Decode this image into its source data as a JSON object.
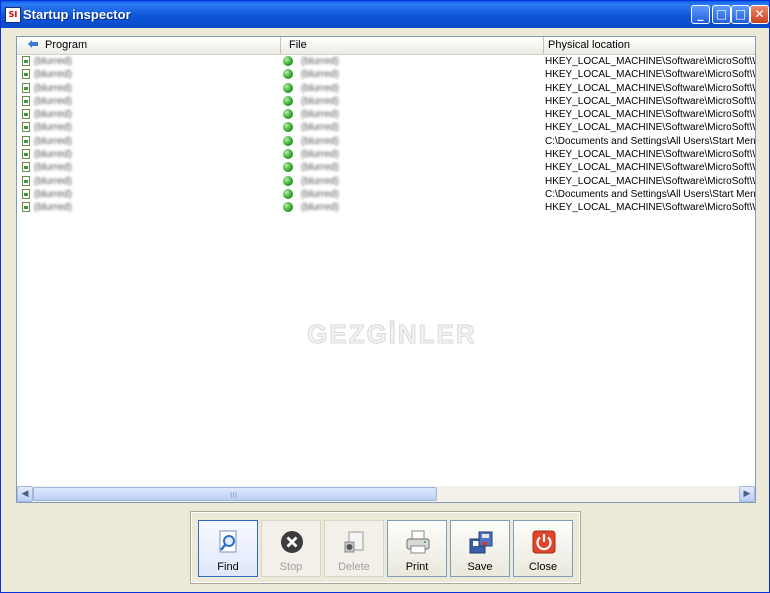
{
  "window": {
    "title": "Startup inspector",
    "app_icon_text": "SI",
    "controls": [
      "_",
      "□",
      "□",
      "✕"
    ]
  },
  "columns": [
    "Program",
    "File",
    "Physical location"
  ],
  "rows": [
    {
      "program": "(blurred)",
      "file": "(blurred)",
      "location": "HKEY_LOCAL_MACHINE\\Software\\MicroSoft\\Window"
    },
    {
      "program": "(blurred)",
      "file": "(blurred)",
      "location": "HKEY_LOCAL_MACHINE\\Software\\MicroSoft\\Window"
    },
    {
      "program": "(blurred)",
      "file": "(blurred)",
      "location": "HKEY_LOCAL_MACHINE\\Software\\MicroSoft\\Window"
    },
    {
      "program": "(blurred)",
      "file": "(blurred)",
      "location": "HKEY_LOCAL_MACHINE\\Software\\MicroSoft\\Window"
    },
    {
      "program": "(blurred)",
      "file": "(blurred)",
      "location": "HKEY_LOCAL_MACHINE\\Software\\MicroSoft\\Window"
    },
    {
      "program": "(blurred)",
      "file": "(blurred)",
      "location": "HKEY_LOCAL_MACHINE\\Software\\MicroSoft\\Window"
    },
    {
      "program": "(blurred)",
      "file": "(blurred)",
      "location": "C:\\Documents and Settings\\All Users\\Start Menu\\Progra"
    },
    {
      "program": "(blurred)",
      "file": "(blurred)",
      "location": "HKEY_LOCAL_MACHINE\\Software\\MicroSoft\\Window"
    },
    {
      "program": "(blurred)",
      "file": "(blurred)",
      "location": "HKEY_LOCAL_MACHINE\\Software\\MicroSoft\\Window"
    },
    {
      "program": "(blurred)",
      "file": "(blurred)",
      "location": "HKEY_LOCAL_MACHINE\\Software\\MicroSoft\\Window"
    },
    {
      "program": "(blurred)",
      "file": "(blurred)",
      "location": "C:\\Documents and Settings\\All Users\\Start Menu\\Progra"
    },
    {
      "program": "(blurred)",
      "file": "(blurred)",
      "location": "HKEY_LOCAL_MACHINE\\Software\\MicroSoft\\Window"
    }
  ],
  "watermark": "GEZGİNLER",
  "scrollbar": {
    "grip": "III"
  },
  "toolbar": {
    "find": "Find",
    "stop": "Stop",
    "delete": "Delete",
    "print": "Print",
    "save": "Save",
    "close": "Close"
  }
}
